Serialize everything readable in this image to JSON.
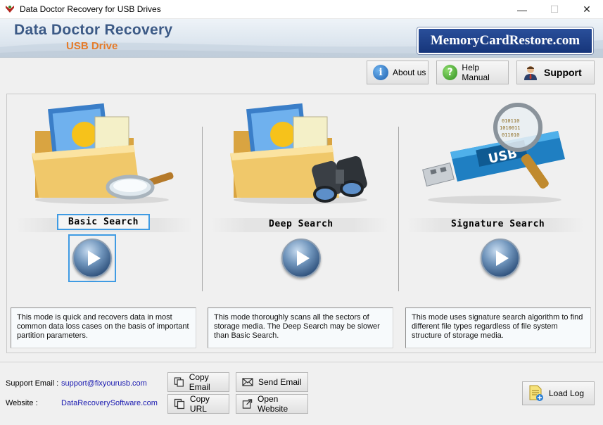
{
  "window": {
    "title": "Data Doctor Recovery for USB Drives",
    "controls": {
      "minimize": "—",
      "maximize": "☐",
      "close": "✕"
    }
  },
  "banner": {
    "title": "Data Doctor Recovery",
    "subtitle": "USB Drive",
    "logo_text": "MemoryCardRestore.com",
    "colors": {
      "title": "#3c5a86",
      "subtitle": "#e57b2a",
      "logo_bg": "#1e3f8a"
    }
  },
  "toolbar": {
    "about_label": "About us",
    "about_icon": "info-icon",
    "help_label": "Help Manual",
    "help_icon": "help-icon",
    "support_label": "Support",
    "support_icon": "user-icon"
  },
  "modes": [
    {
      "label": "Basic Search",
      "image": "folder-magnifier-image",
      "description": "This mode is quick and recovers data in most common data loss cases on the basis of important partition parameters.",
      "selected": true
    },
    {
      "label": "Deep Search",
      "image": "folder-binoculars-image",
      "description": "This mode thoroughly scans all the sectors of storage media. The Deep Search may be slower than Basic Search.",
      "selected": false
    },
    {
      "label": "Signature Search",
      "image": "usb-magnifier-image",
      "description": "This mode uses signature search algorithm to find different file types regardless of file system structure of storage media.",
      "selected": false
    }
  ],
  "footer": {
    "support_email_label": "Support Email :",
    "support_email": "support@fixyourusb.com",
    "website_label": "Website :",
    "website": "DataRecoverySoftware.com",
    "copy_email_label": "Copy Email",
    "send_email_label": "Send Email",
    "copy_url_label": "Copy URL",
    "open_website_label": "Open Website",
    "load_log_label": "Load Log",
    "link_color": "#1a1ab0"
  }
}
